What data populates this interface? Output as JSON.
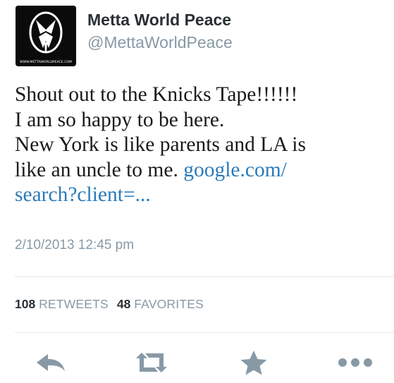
{
  "user": {
    "display_name": "Metta World Peace",
    "handle": "@MettaWorldPeace",
    "avatar_caption": "WWW.METTAWORLDPEACE.COM"
  },
  "tweet": {
    "lines": [
      "Shout out to the Knicks Tape!!!!!!",
      "I am so happy to be here.",
      "New York is like parents and LA is",
      "like an uncle to me. "
    ],
    "link_line1": "google.com/",
    "link_line2": "search?client=...",
    "timestamp": "2/10/2013 12:45 pm"
  },
  "stats": {
    "retweets_count": "108",
    "retweets_label": "RETWEETS",
    "favorites_count": "48",
    "favorites_label": "FAVORITES"
  },
  "actions": {
    "icons": [
      "reply-icon",
      "retweet-icon",
      "favorite-icon",
      "more-icon"
    ]
  },
  "colors": {
    "link": "#2b7bb9",
    "muted": "#8899a6",
    "icon": "#8899a6",
    "divider": "#e1e8ed"
  }
}
